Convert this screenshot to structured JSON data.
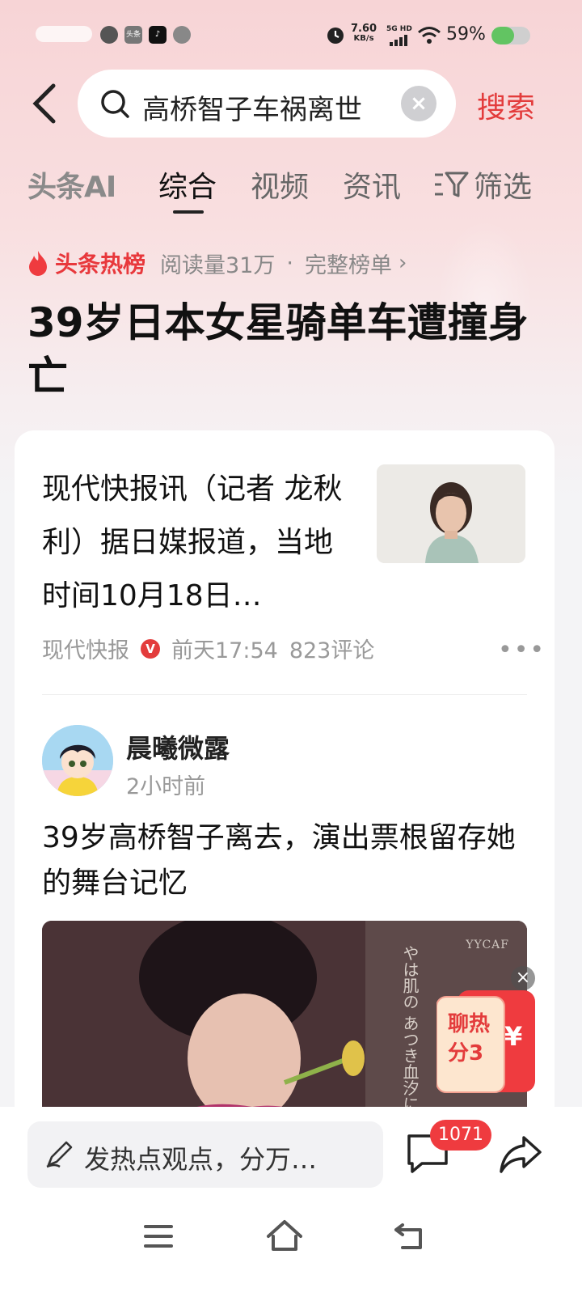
{
  "status_bar": {
    "net_speed": "7.60",
    "net_unit": "KB/s",
    "signal_label": "5G HD",
    "battery": "59%",
    "battery_level": 0.59
  },
  "header": {
    "search_query": "高桥智子车祸离世",
    "search_button": "搜索"
  },
  "tabs": {
    "ai": "头条AI",
    "items": [
      "综合",
      "视频",
      "资讯"
    ],
    "active_index": 0,
    "filter": "筛选"
  },
  "hot": {
    "title": "头条热榜",
    "reads": "阅读量31万",
    "separator": "·",
    "full_list": "完整榜单",
    "headline": "39岁日本女星骑单车遭撞身亡"
  },
  "news": {
    "text": "现代快报讯（记者 龙秋利）据日媒报道，当地时间10月18日…",
    "source": "现代快报",
    "verified_mark": "V",
    "time": "前天17:54",
    "comments": "823评论"
  },
  "post": {
    "author": "晨曦微露",
    "time": "2小时前",
    "text": "39岁高桥智子离去，演出票根留存她的舞台记忆",
    "image_text": "やは肌の あつき血汐に",
    "image_brand": "YYCAF"
  },
  "promo": {
    "line1": "聊热",
    "line2": "分3",
    "currency": "¥",
    "close": "×"
  },
  "bottom": {
    "comment_placeholder": "发热点观点，分万…",
    "comment_count": "1071"
  },
  "colors": {
    "accent": "#e33c3c",
    "badge": "#ef3b3f",
    "battery": "#62c462"
  }
}
